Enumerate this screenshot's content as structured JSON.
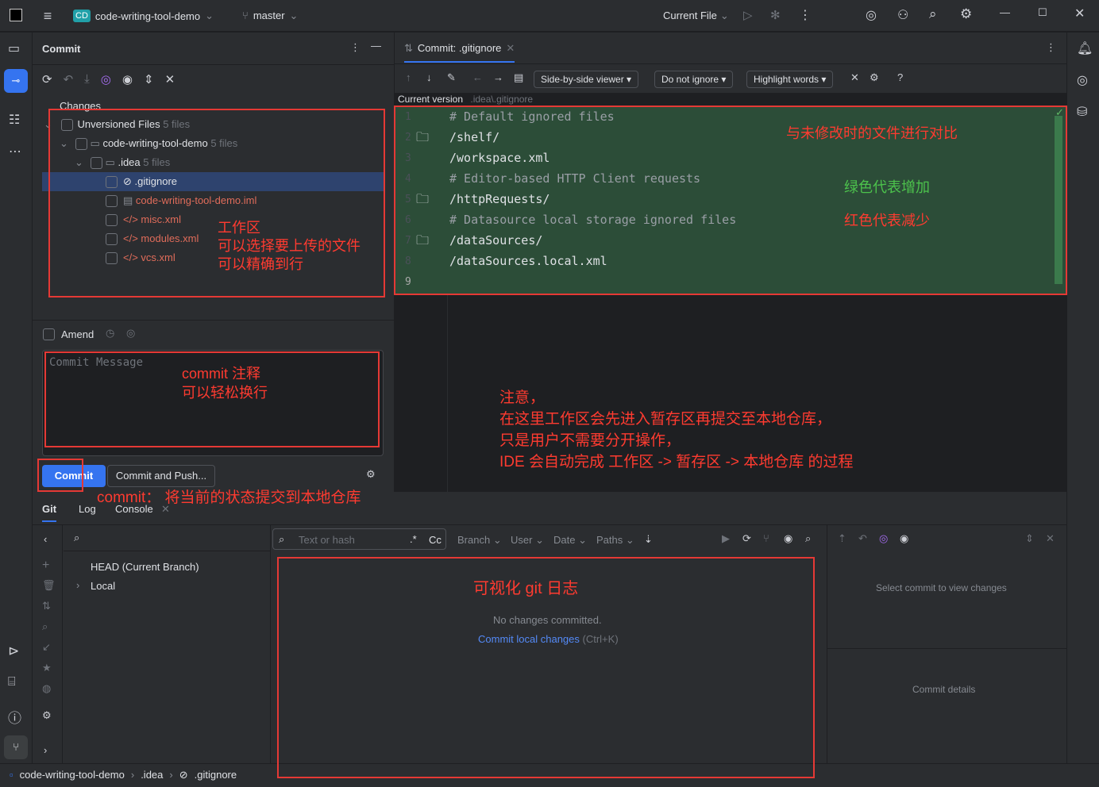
{
  "titlebar": {
    "project_badge": "CD",
    "project": "code-writing-tool-demo",
    "branch": "master",
    "run_config": "Current File"
  },
  "commit_panel": {
    "title": "Commit",
    "changes_label": "Changes",
    "tree": [
      {
        "label": "Unversioned Files",
        "count": "5 files"
      },
      {
        "label": "code-writing-tool-demo",
        "count": "5 files"
      },
      {
        "label": ".idea",
        "count": "5 files"
      },
      {
        "label": ".gitignore"
      },
      {
        "label": "code-writing-tool-demo.iml"
      },
      {
        "label": "misc.xml"
      },
      {
        "label": "modules.xml"
      },
      {
        "label": "vcs.xml"
      }
    ],
    "amend": "Amend",
    "message_placeholder": "Commit Message",
    "commit_btn": "Commit",
    "commit_push_btn": "Commit and Push..."
  },
  "diff": {
    "tab": "Commit: .gitignore",
    "viewer": "Side-by-side viewer",
    "ignore": "Do not ignore",
    "highlight": "Highlight words",
    "current_version": "Current version",
    "path": ".idea\\.gitignore",
    "lines": [
      {
        "n": "1",
        "text": "# Default ignored files",
        "comment": true
      },
      {
        "n": "2",
        "text": "/shelf/"
      },
      {
        "n": "3",
        "text": "/workspace.xml"
      },
      {
        "n": "4",
        "text": "# Editor-based HTTP Client requests",
        "comment": true
      },
      {
        "n": "5",
        "text": "/httpRequests/"
      },
      {
        "n": "6",
        "text": "# Datasource local storage ignored files",
        "comment": true
      },
      {
        "n": "7",
        "text": "/dataSources/"
      },
      {
        "n": "8",
        "text": "/dataSources.local.xml"
      },
      {
        "n": "9",
        "text": ""
      }
    ]
  },
  "bottom": {
    "tabs": [
      "Git",
      "Log",
      "Console"
    ],
    "head": "HEAD (Current Branch)",
    "local": "Local",
    "search_placeholder": "Text or hash",
    "regex": ".*",
    "case": "Cc",
    "filters": [
      "Branch",
      "User",
      "Date",
      "Paths"
    ],
    "no_changes": "No changes committed.",
    "commit_link": "Commit local changes",
    "shortcut": "(Ctrl+K)",
    "select_commit": "Select commit to view changes",
    "commit_details": "Commit details"
  },
  "breadcrumb": [
    "code-writing-tool-demo",
    ".idea",
    ".gitignore"
  ],
  "annotations": {
    "compare": "与未修改时的文件进行对比",
    "green": "绿色代表增加",
    "red": "红色代表减少",
    "workspace1": "工作区",
    "workspace2": "可以选择要上传的文件",
    "workspace3": "可以精确到行",
    "msg1": "commit 注释",
    "msg2": "可以轻松换行",
    "note1": "注意，",
    "note2": "在这里工作区会先进入暂存区再提交至本地仓库，",
    "note3": "只是用户不需要分开操作，",
    "note4": "IDE 会自动完成 工作区 -> 暂存区 -> 本地仓库 的过程",
    "commit_note": "commit： 将当前的状态提交到本地仓库",
    "gitlog": "可视化 git 日志"
  }
}
